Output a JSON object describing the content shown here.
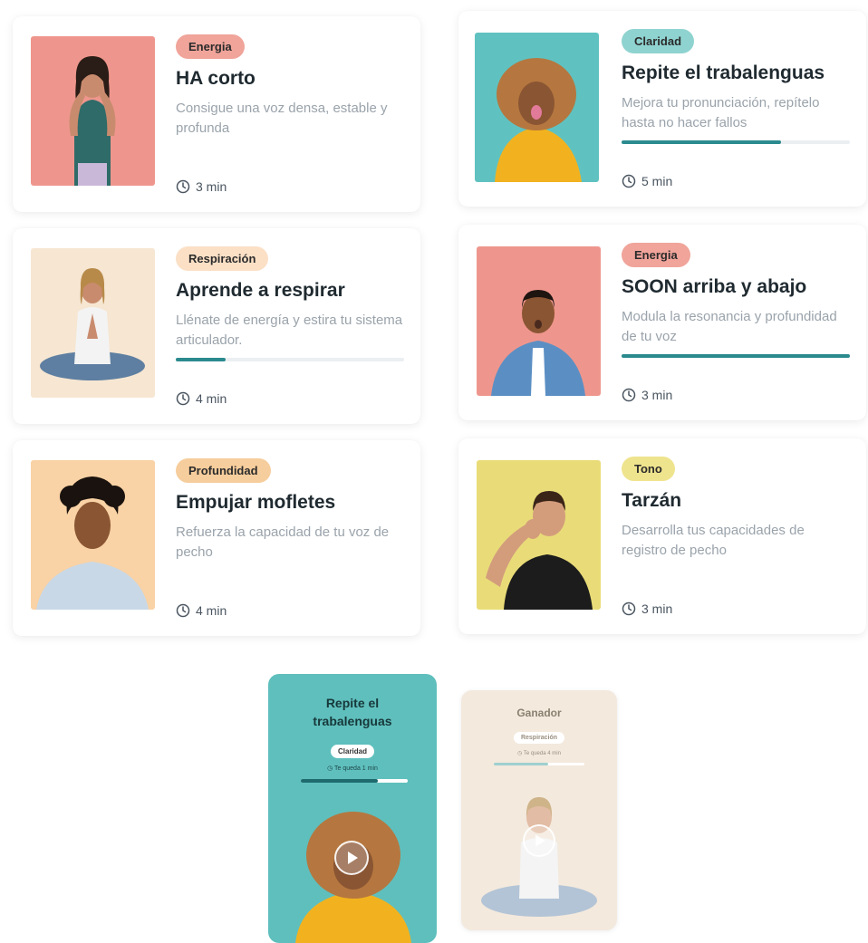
{
  "cards": [
    {
      "tag": "Energia",
      "tag_color": "#f0a49a",
      "title": "HA corto",
      "desc": "Consigue una voz densa, estable y profunda",
      "duration": "3 min",
      "photo_bg": "#ee968d"
    },
    {
      "tag": "Claridad",
      "tag_color": "#8fd3d0",
      "title": "Repite el trabalenguas",
      "desc": "Mejora tu pronunciación, repítelo hasta no hacer fallos",
      "duration": "5 min",
      "progress": 0.7,
      "photo_bg": "#5fc2c0"
    },
    {
      "tag": "Respiración",
      "tag_color": "#fbe0c6",
      "title": "Aprende a respirar",
      "desc": "Llénate de energía y estira tu sistema articulador.",
      "duration": "4 min",
      "progress": 0.22,
      "photo_bg": "#f6e6d2"
    },
    {
      "tag": "Energia",
      "tag_color": "#f0a49a",
      "title": "SOON arriba y abajo",
      "desc": "Modula la resonancia y profundidad de tu voz",
      "duration": "3 min",
      "progress": 1.0,
      "photo_bg": "#ee968d"
    },
    {
      "tag": "Profundidad",
      "tag_color": "#f6cd9c",
      "title": "Empujar mofletes",
      "desc": "Refuerza la capacidad de tu voz de pecho",
      "duration": "4 min",
      "photo_bg": "#f9d2a5"
    },
    {
      "tag": "Tono",
      "tag_color": "#efe48e",
      "title": "Tarzán",
      "desc": "Desarrolla tus capacidades de registro de pecho",
      "duration": "3 min",
      "photo_bg": "#e9dc78"
    }
  ],
  "phones": [
    {
      "title": "Repite el trabalenguas",
      "tag": "Claridad",
      "sub": "Te queda 1 min",
      "progress": 0.72,
      "bg": "#5fbfbd"
    },
    {
      "title": "Ganador",
      "tag": "Respiración",
      "sub": "Te queda 4 min",
      "progress": 0.6,
      "bg": "#f3e9dd"
    }
  ]
}
